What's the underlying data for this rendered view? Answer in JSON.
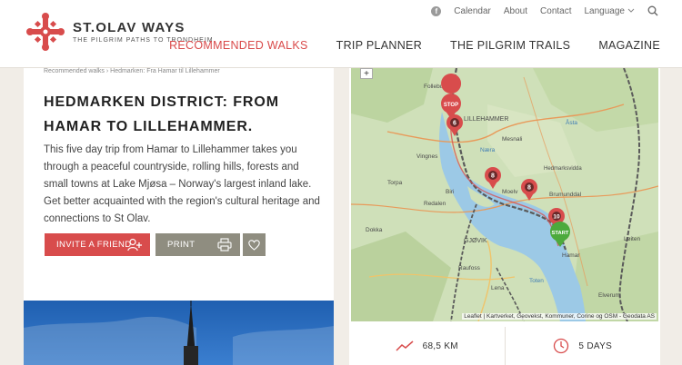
{
  "brand": {
    "name": "ST.OLAV WAYS",
    "tagline": "THE PILGRIM PATHS TO TRONDHEIM"
  },
  "topnav": {
    "items": [
      "Calendar",
      "About",
      "Contact",
      "Language"
    ]
  },
  "mainnav": {
    "items": [
      "RECOMMENDED WALKS",
      "TRIP PLANNER",
      "THE PILGRIM TRAILS",
      "MAGAZINE"
    ],
    "active_index": 0
  },
  "breadcrumb": "Recommended walks › Hedmarken: Fra Hamar til Lillehammer",
  "page_title": "HEDMARKEN DISTRICT: FROM HAMAR TO LILLEHAMMER.",
  "description": "This five day trip from Hamar to Lillehammer takes you through a peaceful countryside, rolling hills, forests and small towns at Lake Mjøsa – Norway's largest inland lake. Get better acquainted with the region's cultural heritage and connections to St Olav.",
  "buttons": {
    "invite": "INVITE A FRIEND",
    "print": "PRINT"
  },
  "map": {
    "zoom_label": "+",
    "attribution": "Leaflet | Kartverket, Geovekst, Kommuner, Corine og OSM - Geodata AS",
    "markers": {
      "stop": "STOP",
      "m6": "6",
      "m8a": "8",
      "m8b": "8",
      "m10": "10",
      "start": "START"
    },
    "places": {
      "lillehammer": "LILLEHAMMER",
      "vingnes": "Vingnes",
      "mesnali": "Mesnali",
      "naera": "Næra",
      "asta": "Åsta",
      "hedmarksvidda": "Hedmarksvidda",
      "biri": "Biri",
      "moelv": "Moelv",
      "brumunddal": "Brumunddal",
      "redalen": "Redalen",
      "gjovik": "GJØVIK",
      "dokka": "Dokka",
      "raufoss": "Raufoss",
      "hamar": "Hamar",
      "loiten": "Løiten",
      "toten": "Toten",
      "lena": "Lena",
      "follebu": "Follebu",
      "torpa": "Torpa",
      "elverum": "Elverum"
    },
    "colors": {
      "water": "#9cc9e6",
      "land": "#cfe0b9",
      "trail": "#5a5a5a",
      "marker": "#d84c4c",
      "start": "#4caa3c"
    }
  },
  "stats": {
    "distance": "68,5 KM",
    "duration": "5 DAYS"
  },
  "colors": {
    "accent": "#d84c4c",
    "button_grey": "#8f8d80"
  }
}
